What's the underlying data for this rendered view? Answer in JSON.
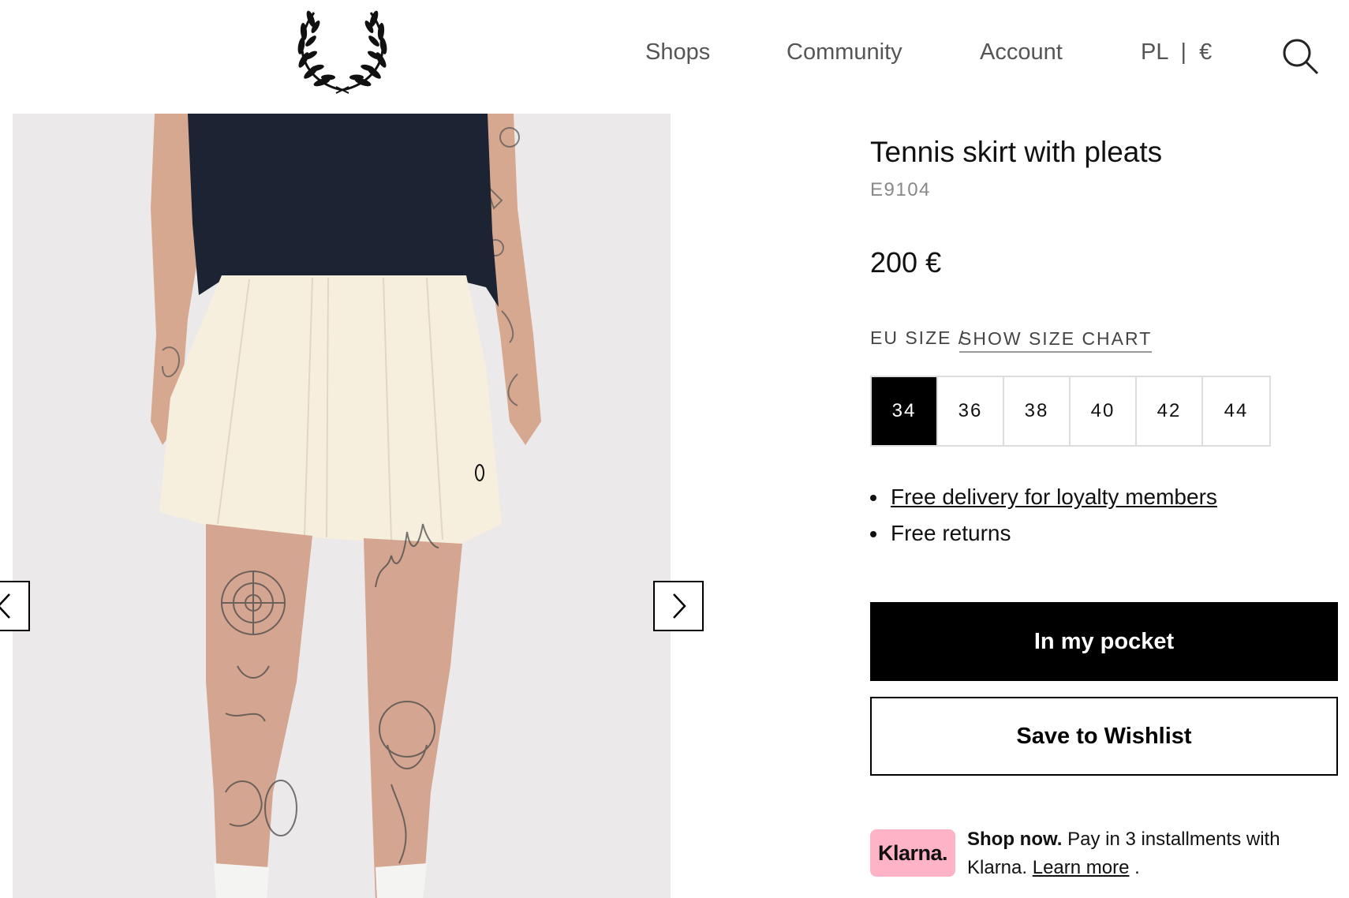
{
  "header": {
    "logo_icon": "laurel-wreath-icon",
    "nav": {
      "shops": "Shops",
      "community": "Community",
      "account": "Account",
      "locale": "PL  |  €"
    },
    "search_icon": "search-icon"
  },
  "gallery": {
    "prev_icon": "chevron-left-icon",
    "next_icon": "chevron-right-icon"
  },
  "product": {
    "title": "Tennis skirt with pleats",
    "sku": "E9104",
    "price": "200 €",
    "size_label": "EU SIZE /",
    "size_chart_link": "SHOW SIZE CHART",
    "sizes": [
      "34",
      "36",
      "38",
      "40",
      "42",
      "44"
    ],
    "selected_size": "34",
    "perks": {
      "delivery": "Free delivery for loyalty members",
      "returns": "Free returns"
    },
    "add_to_cart": "In my pocket",
    "wishlist": "Save to Wishlist"
  },
  "klarna": {
    "badge": "Klarna.",
    "bold": "Shop now.",
    "text": " Pay in 3 installments with Klarna. ",
    "link": "Learn more",
    "suffix": " ."
  },
  "colors": {
    "primary": "#000000",
    "klarna_pink": "#ffb3c7",
    "nav_gray": "#555555",
    "photo_bg": "#ebe9ea",
    "shirt_navy": "#1c2433",
    "skirt_cream": "#f7efde"
  }
}
